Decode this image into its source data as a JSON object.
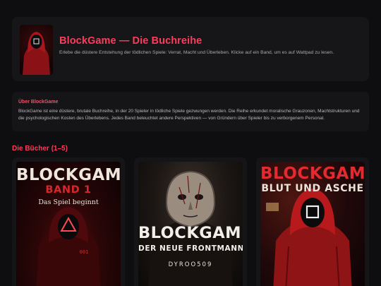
{
  "header": {
    "title": "BlockGame — Die Buchreihe",
    "subtitle": "Erlebe die düstere Entstehung der tödlichen Spiele: Verrat, Macht und Überleben. Klicke auf ein Band, um es auf Wattpad zu lesen."
  },
  "about": {
    "title": "Über BlockGame",
    "text": "BlockGame ist eine düstere, brutale Buchreihe, in der 20 Spieler in tödliche Spiele gezwungen werden. Die Reihe erkundet moralische Grauzonen, Machtstrukturen und die psychologischen Kosten des Überlebens. Jedes Band beleuchtet andere Perspektiven — von Gründern über Spieler bis zu verborgenem Personal."
  },
  "books_section": {
    "title": "Die Bücher (1–5)",
    "books": [
      {
        "cover_title": "BLOCKGAME",
        "cover_line2": "BAND 1",
        "cover_line3": "Das Spiel beginnt",
        "cover_badge": "001"
      },
      {
        "cover_title": "BLOCKGAME",
        "cover_line2": "DER NEUE FRONTMANN",
        "cover_line3": "DYROO509"
      },
      {
        "cover_title": "BLOCKGAME",
        "cover_line2": "BLUT UND ASCHE"
      }
    ]
  },
  "colors": {
    "accent": "#ff3b5c",
    "background": "#0e0e10",
    "card": "#151517"
  }
}
